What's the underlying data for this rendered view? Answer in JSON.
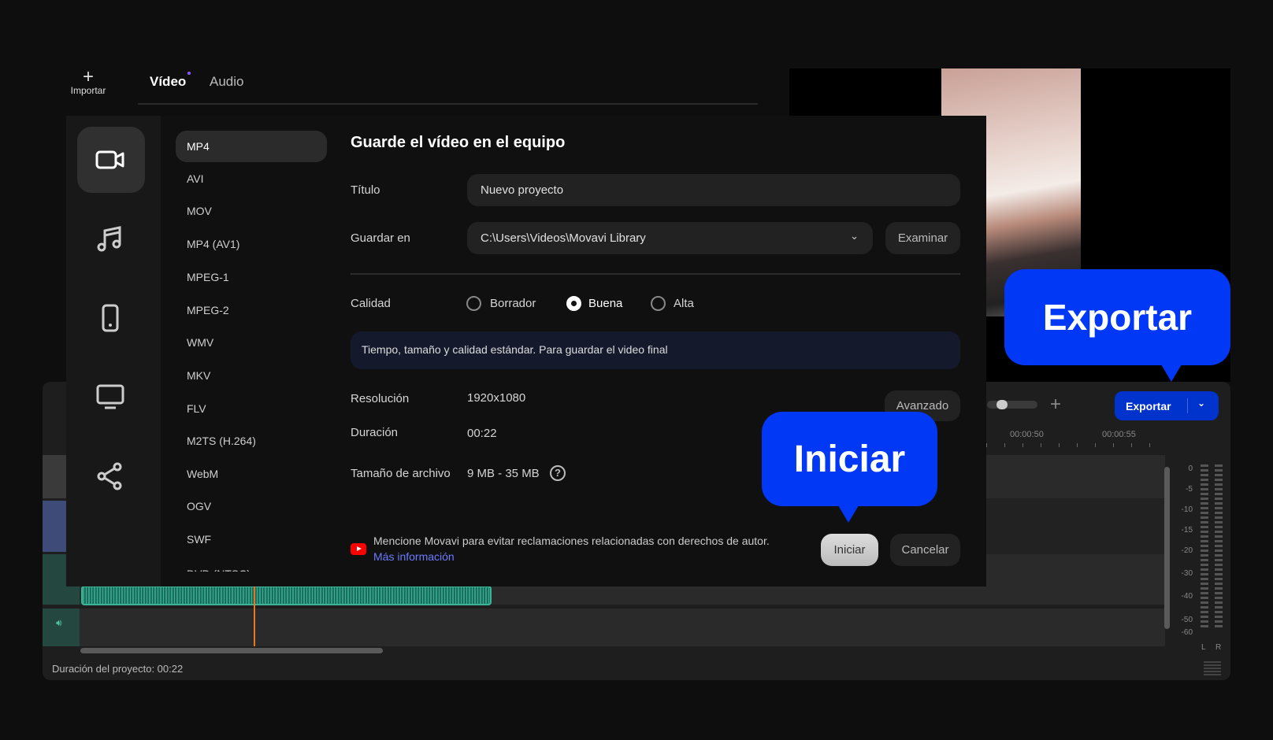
{
  "toolbar": {
    "import_label": "Importar"
  },
  "tabs": [
    {
      "label": "Vídeo",
      "active": true
    },
    {
      "label": "Audio",
      "active": false
    }
  ],
  "export_button": {
    "label": "Exportar"
  },
  "timeline": {
    "timestamps": [
      "00:00:50",
      "00:00:55"
    ],
    "meter_scale": [
      "0",
      "-5",
      "-10",
      "-15",
      "-20",
      "-30",
      "-40",
      "-50",
      "-60"
    ],
    "meter_channels": [
      "L",
      "R"
    ],
    "project_duration": "Duración del proyecto: 00:22"
  },
  "dialog": {
    "categories": [
      "video-icon",
      "music-icon",
      "phone-icon",
      "monitor-icon",
      "share-icon"
    ],
    "formats": [
      "MP4",
      "AVI",
      "MOV",
      "MP4 (AV1)",
      "MPEG-1",
      "MPEG-2",
      "WMV",
      "MKV",
      "FLV",
      "M2TS (H.264)",
      "WebM",
      "OGV",
      "SWF",
      "DVD (NTSC)"
    ],
    "selected_format": "MP4",
    "heading": "Guarde el vídeo en el equipo",
    "title_label": "Título",
    "title_value": "Nuevo proyecto",
    "save_label": "Guardar en",
    "save_value": "C:\\Users\\Videos\\Movavi Library",
    "browse_label": "Examinar",
    "quality_label": "Calidad",
    "quality_options": [
      "Borrador",
      "Buena",
      "Alta"
    ],
    "quality_selected": "Buena",
    "quality_info": "Tiempo, tamaño y calidad estándar. Para guardar el video final",
    "resolution_label": "Resolución",
    "resolution_value": "1920x1080",
    "duration_label": "Duración",
    "duration_value": "00:22",
    "filesize_label": "Tamaño de archivo",
    "filesize_value": "9 MB - 35 MB",
    "advanced_label": "Avanzado",
    "notice": "Mencione Movavi para evitar reclamaciones relacionadas con derechos de autor.",
    "more_info": "Más información",
    "start_label": "Iniciar",
    "cancel_label": "Cancelar"
  },
  "callouts": {
    "start": "Iniciar",
    "export": "Exportar"
  },
  "colors": {
    "accent": "#0038f5",
    "waveform": "#2e9e86",
    "playhead": "#e87722",
    "link": "#6b7bff"
  }
}
